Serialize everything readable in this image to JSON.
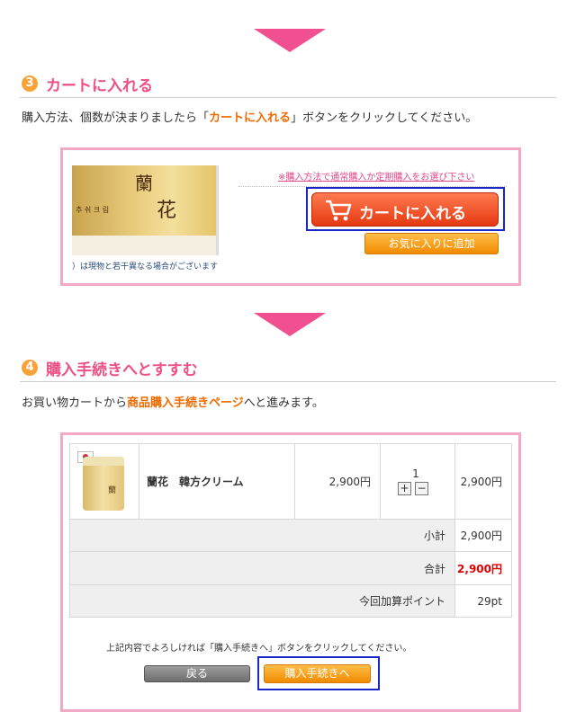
{
  "step3": {
    "number": "3",
    "title": "カートに入れる",
    "desc_before": "購入方法、個数が決まりましたら「",
    "desc_highlight": "カートに入れる",
    "desc_after": "」ボタンをクリックしてください。",
    "image_text_1": "蘭",
    "image_text_2": "花",
    "image_text_hangul": "추 쉬  크 림",
    "image_caption": "）は現物と若干異なる場合がございます",
    "notice_link": "※購入方法で通常購入か定期購入をお選び下さい",
    "cart_button": "カートに入れる",
    "favorite_button": "お気に入りに追加"
  },
  "step4": {
    "number": "4",
    "title": "購入手続きへとすすむ",
    "desc_before": "お買い物カートから",
    "desc_highlight": "商品購入手続きページ",
    "desc_after": "へと進みます。",
    "item": {
      "name": "蘭花　韓方クリーム",
      "price": "2,900円",
      "quantity": "1",
      "subtotal": "2,900円",
      "image_text": "蘭"
    },
    "summary": [
      {
        "label": "小計",
        "value": "2,900円"
      },
      {
        "label": "合計",
        "value": "2,900円"
      },
      {
        "label": "今回加算ポイント",
        "value": "29pt"
      }
    ],
    "confirm_text": "上記内容でよろしければ「購入手続きへ」ボタンをクリックしてください。",
    "back_button": "戻る",
    "proceed_button": "購入手続きへ"
  },
  "colors": {
    "step_title": "#ee4f84",
    "highlight": "#ee6a00",
    "total_price": "#e00000",
    "frame": "#f3a9c6",
    "focus_outline": "#1a27c8"
  }
}
